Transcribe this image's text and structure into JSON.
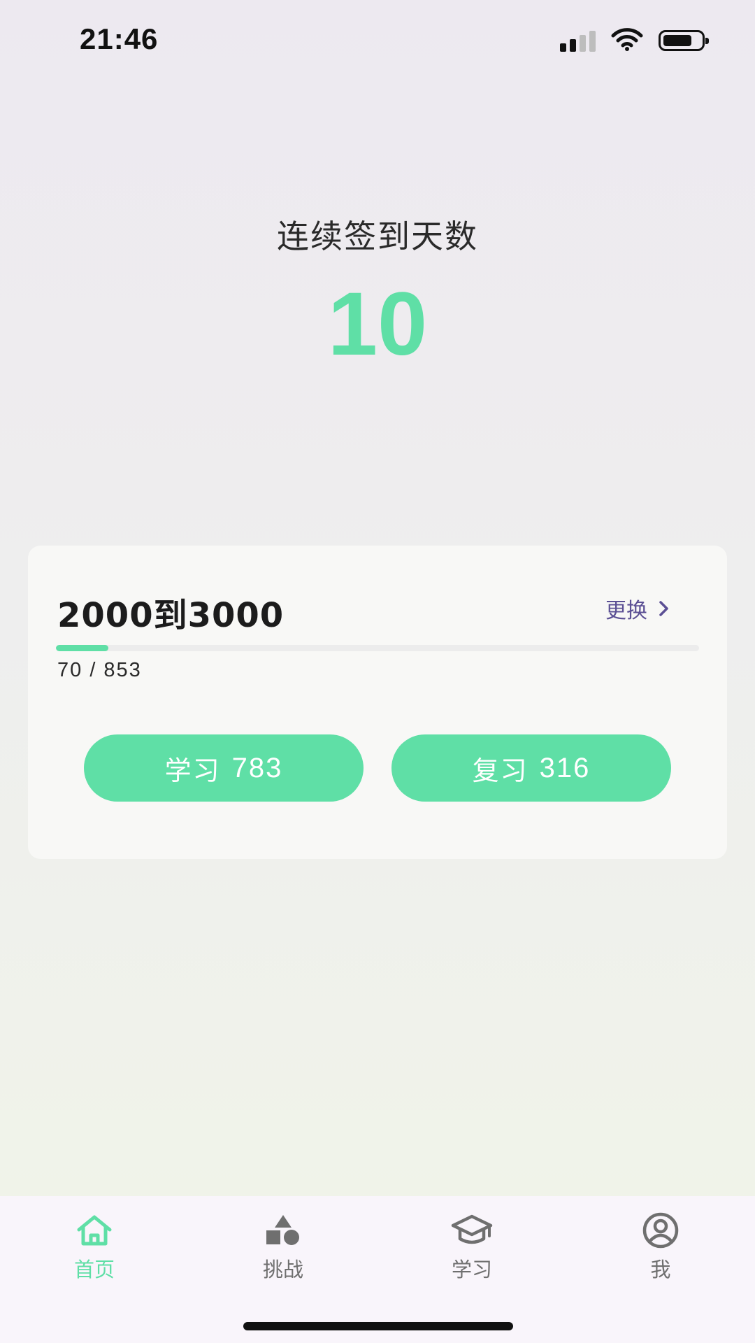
{
  "status_bar": {
    "time": "21:46",
    "icons": [
      "signal-icon",
      "wifi-icon",
      "battery-icon"
    ]
  },
  "streak": {
    "label": "连续签到天数",
    "value": "10"
  },
  "word_card": {
    "title": "2000到3000",
    "change_label": "更换",
    "progress_text": "70 / 853",
    "progress": {
      "current": 70,
      "total": 853
    },
    "learn_button": {
      "label": "学习",
      "count": "783"
    },
    "review_button": {
      "label": "复习",
      "count": "316"
    }
  },
  "tab_bar": {
    "tabs": [
      {
        "label": "首页",
        "icon": "home-icon",
        "active": true
      },
      {
        "label": "挑战",
        "icon": "shapes-icon",
        "active": false
      },
      {
        "label": "学习",
        "icon": "graduation-cap-icon",
        "active": false
      },
      {
        "label": "我",
        "icon": "user-circle-icon",
        "active": false
      }
    ]
  },
  "colors": {
    "accent": "#5fdfa6",
    "link": "#5b4f94",
    "tab_inactive": "#6f6f6f"
  }
}
